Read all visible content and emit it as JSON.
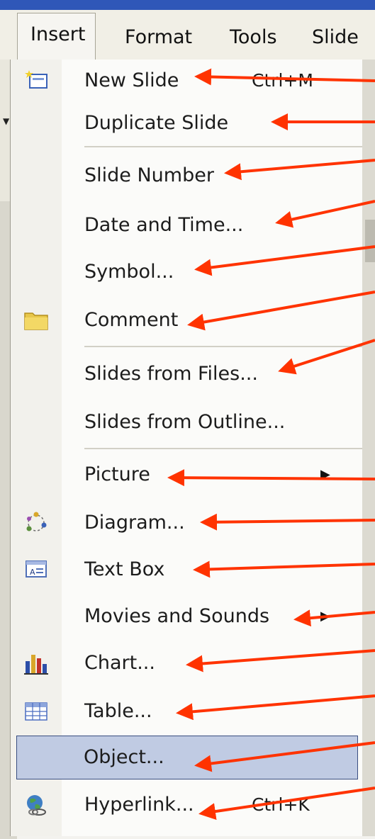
{
  "menubar": {
    "items": [
      {
        "label": "Insert",
        "active": true
      },
      {
        "label": "Format"
      },
      {
        "label": "Tools"
      },
      {
        "label": "Slide S"
      }
    ]
  },
  "menu": {
    "items": [
      {
        "label": "New Slide",
        "shortcut": "Ctrl+M",
        "icon": "new-slide-icon"
      },
      {
        "label": "Duplicate Slide"
      },
      {
        "label": "Slide Number"
      },
      {
        "label": "Date and Time..."
      },
      {
        "label": "Symbol..."
      },
      {
        "label": "Comment",
        "icon": "comment-folder-icon"
      },
      {
        "label": "Slides from Files..."
      },
      {
        "label": "Slides from Outline..."
      },
      {
        "label": "Picture",
        "submenu": true
      },
      {
        "label": "Diagram...",
        "icon": "diagram-icon"
      },
      {
        "label": "Text Box",
        "icon": "text-box-icon"
      },
      {
        "label": "Movies and Sounds",
        "submenu": true
      },
      {
        "label": "Chart...",
        "icon": "chart-icon"
      },
      {
        "label": "Table...",
        "icon": "table-icon"
      },
      {
        "label": "Object...",
        "selected": true
      },
      {
        "label": "Hyperlink...",
        "shortcut": "Ctrl+K",
        "icon": "hyperlink-globe-icon"
      }
    ],
    "submenu_glyph": "▶"
  },
  "colors": {
    "annotation_arrow": "#ff3300",
    "selection_bg": "#c0cbe3",
    "titlebar": "#2f57b8"
  }
}
